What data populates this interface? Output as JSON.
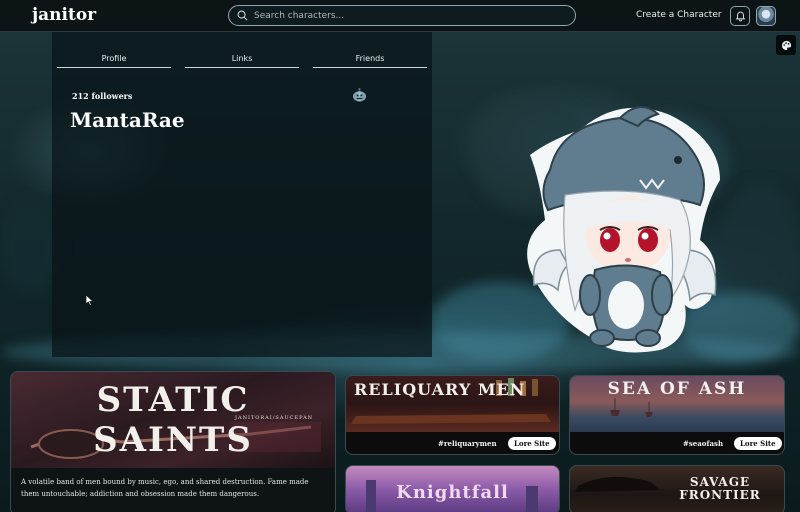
{
  "header": {
    "logo": "janitor",
    "search_placeholder": "Search characters...",
    "create_label": "Create a Character"
  },
  "profile": {
    "tabs": [
      {
        "label": "Profile"
      },
      {
        "label": "Links"
      },
      {
        "label": "Friends"
      }
    ],
    "followers": "212 followers",
    "username": "MantaRae"
  },
  "cards": [
    {
      "title": "STATIC SAINTS",
      "subtitle": "JANITORAI/SAUCEPAN",
      "description": "A volatile band of men bound by music, ego, and shared destruction. Fame made them untouchable; addiction and obsession made them dangerous."
    },
    {
      "title": "RELIQUARY MEN",
      "tag": "#reliquarymen",
      "button": "Lore Site"
    },
    {
      "title": "SEA OF ASH",
      "tag": "#seaofash",
      "button": "Lore Site"
    },
    {
      "title": "Knightfall"
    },
    {
      "title": "SAVAGE FRONTIER"
    }
  ],
  "icons": {
    "search": "search-icon",
    "bell": "bell-icon",
    "palette": "palette-icon",
    "pumpkin": "pumpkin-icon",
    "cursor": "cursor-icon"
  }
}
